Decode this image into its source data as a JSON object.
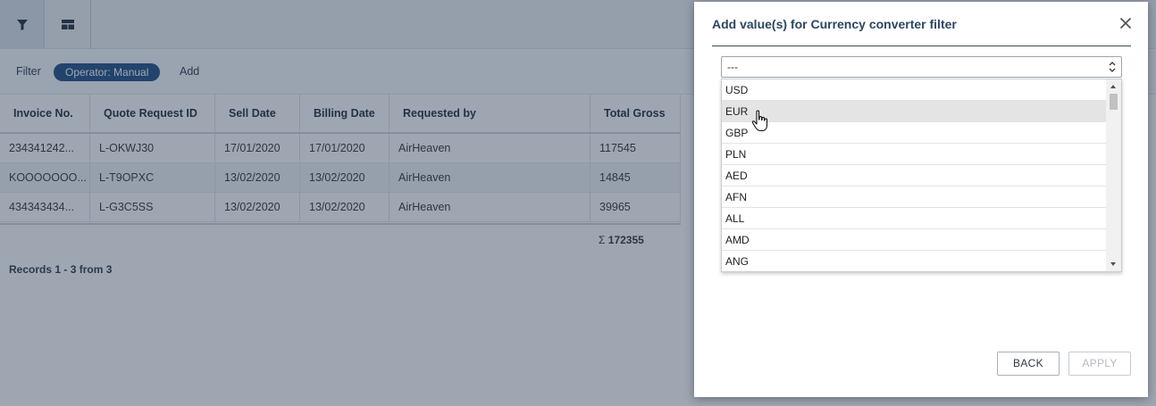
{
  "toolbar": {
    "buttons": [
      {
        "icon": "filter-icon"
      },
      {
        "icon": "layout-icon"
      }
    ]
  },
  "filter_bar": {
    "label": "Filter",
    "chip": "Operator: Manual",
    "add": "Add"
  },
  "grid": {
    "columns": [
      "Invoice No.",
      "Quote Request ID",
      "Sell Date",
      "Billing Date",
      "Requested by",
      "Total Gross"
    ],
    "rows": [
      [
        "234341242...",
        "L-OKWJ30",
        "17/01/2020",
        "17/01/2020",
        "AirHeaven",
        "117545"
      ],
      [
        "KOOOOOOO...",
        "L-T9OPXC",
        "13/02/2020",
        "13/02/2020",
        "AirHeaven",
        "14845"
      ],
      [
        "434343434...",
        "L-G3C5SS",
        "13/02/2020",
        "13/02/2020",
        "AirHeaven",
        "39965"
      ]
    ],
    "sum_symbol": "Σ",
    "sum_value": "172355",
    "records": "Records 1 - 3 from 3"
  },
  "modal": {
    "title": "Add value(s) for Currency converter filter",
    "select_value": "---",
    "options": [
      "USD",
      "EUR",
      "GBP",
      "PLN",
      "AED",
      "AFN",
      "ALL",
      "AMD",
      "ANG"
    ],
    "highlighted_option": "EUR",
    "back_label": "BACK",
    "apply_label": "APPLY"
  },
  "colors": {
    "chip": "#1e4c80",
    "title": "#2c4661",
    "overlay": "rgba(40,58,85,0.45)",
    "highlight": "#e4e4e4"
  }
}
